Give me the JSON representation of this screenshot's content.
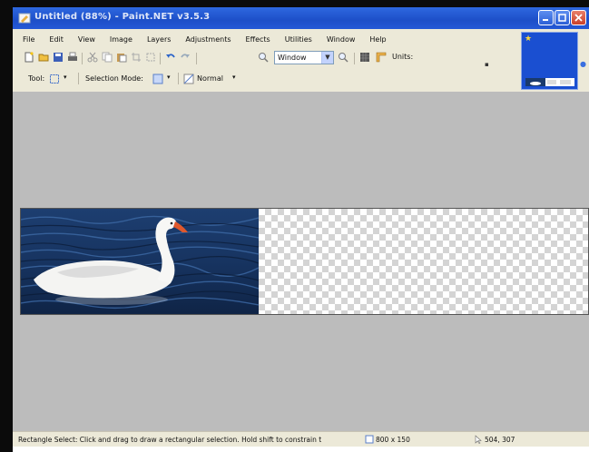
{
  "window": {
    "title": "Untitled (88%) - Paint.NET v3.5.3"
  },
  "menu": [
    {
      "label": "File"
    },
    {
      "label": "Edit"
    },
    {
      "label": "View"
    },
    {
      "label": "Image"
    },
    {
      "label": "Layers"
    },
    {
      "label": "Adjustments"
    },
    {
      "label": "Effects"
    },
    {
      "label": "Utilities"
    },
    {
      "label": "Window"
    },
    {
      "label": "Help"
    }
  ],
  "toolbar": {
    "zoom_select_value": "Window",
    "units_label": "Units:"
  },
  "tool_options": {
    "tool_label": "Tool:",
    "selection_mode_label": "Selection Mode:",
    "blend_mode_value": "Normal"
  },
  "status": {
    "hint": "Rectangle Select: Click and drag to draw a rectangular selection. Hold shift to constrain t",
    "image_size": "800 x 150",
    "cursor_position": "504, 307"
  },
  "colors": {
    "titlebar": "#1d4fc8",
    "workspace": "#bcbcbc",
    "chrome": "#ece9d8"
  }
}
